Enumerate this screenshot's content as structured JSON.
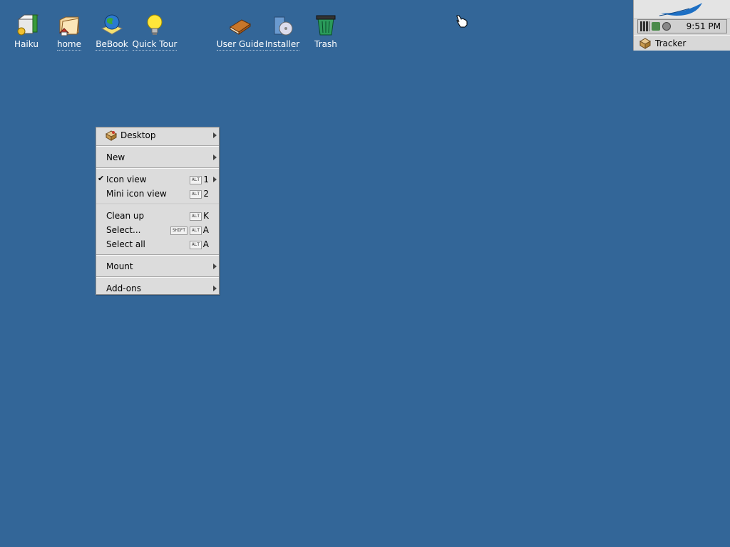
{
  "desktop": {
    "icons": [
      {
        "label": "Haiku"
      },
      {
        "label": "home"
      },
      {
        "label": "BeBook"
      },
      {
        "label": "Quick Tour"
      },
      {
        "label": "User Guide"
      },
      {
        "label": "Installer"
      },
      {
        "label": "Trash"
      }
    ],
    "background_color": "#336698"
  },
  "deskbar": {
    "clock": "9:51 PM",
    "tracker_label": "Tracker"
  },
  "context_menu": {
    "desktop": "Desktop",
    "new": "New",
    "icon_view": "Icon view",
    "icon_view_mod": "ALT",
    "icon_view_key": "1",
    "mini_icon_view": "Mini icon view",
    "mini_icon_view_mod": "ALT",
    "mini_icon_view_key": "2",
    "clean_up": "Clean up",
    "clean_up_mod": "ALT",
    "clean_up_key": "K",
    "select": "Select...",
    "select_mod_shift": "SHIFT",
    "select_mod": "ALT",
    "select_key": "A",
    "select_all": "Select all",
    "select_all_mod": "ALT",
    "select_all_key": "A",
    "mount": "Mount",
    "add_ons": "Add-ons",
    "checkmark": "✔"
  }
}
